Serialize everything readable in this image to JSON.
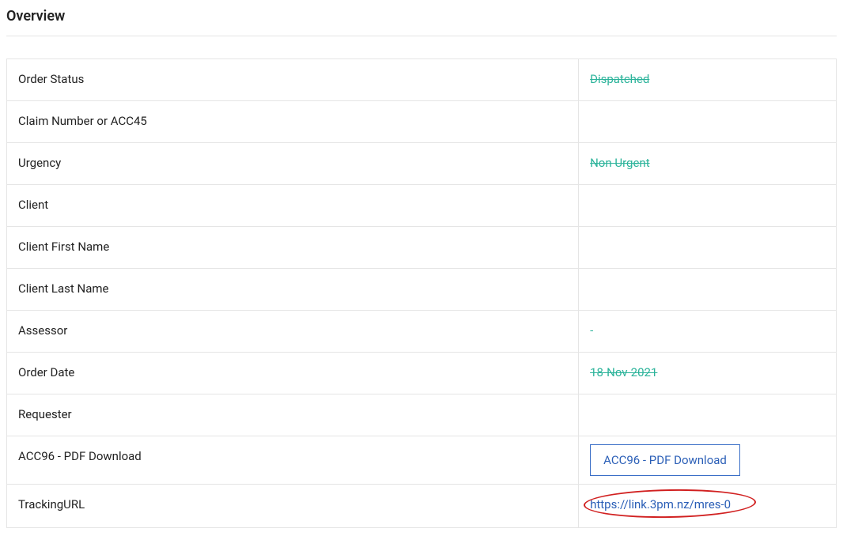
{
  "section": {
    "title": "Overview"
  },
  "rows": {
    "order_status": {
      "label": "Order Status",
      "value": "Dispatched"
    },
    "claim_number": {
      "label": "Claim Number or ACC45",
      "value": ""
    },
    "urgency": {
      "label": "Urgency",
      "value": "Non Urgent"
    },
    "client": {
      "label": "Client",
      "value": ""
    },
    "client_first_name": {
      "label": "Client First Name",
      "value": ""
    },
    "client_last_name": {
      "label": "Client Last Name",
      "value": ""
    },
    "assessor": {
      "label": "Assessor",
      "value": "-"
    },
    "order_date": {
      "label": "Order Date",
      "value": "18-Nov-2021"
    },
    "requester": {
      "label": "Requester",
      "value": ""
    },
    "acc96": {
      "label": "ACC96 - PDF Download",
      "button": "ACC96 - PDF Download"
    },
    "tracking": {
      "label": "TrackingURL",
      "url": "https://link.3pm.nz/mres-0"
    }
  }
}
